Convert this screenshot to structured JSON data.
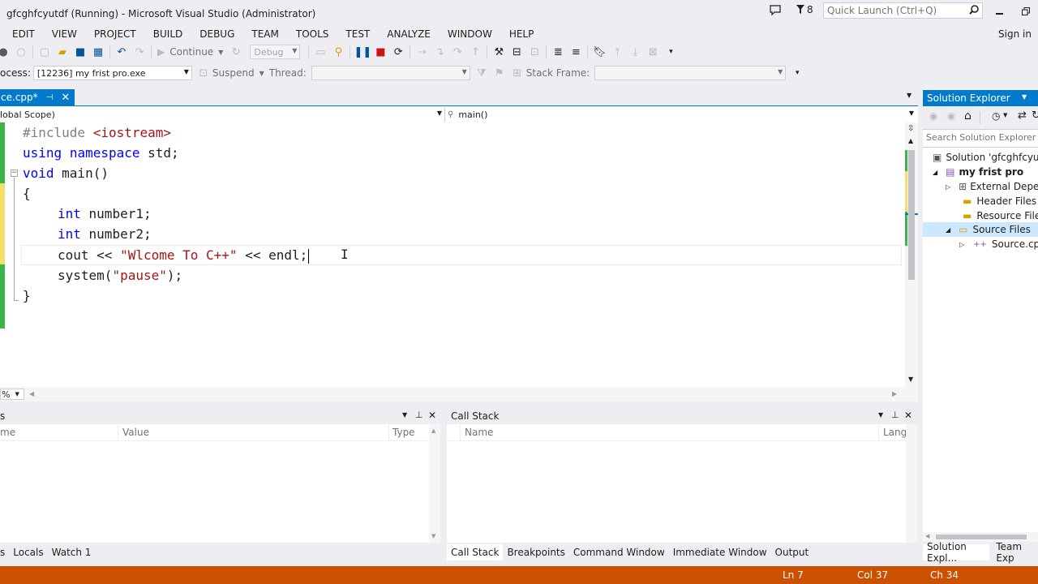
{
  "window": {
    "title": "gfcghfcyutdf (Running) - Microsoft Visual Studio (Administrator)",
    "notification_count": "8",
    "quick_launch_placeholder": "Quick Launch (Ctrl+Q)",
    "sign_in": "Sign in"
  },
  "menu": [
    "EDIT",
    "VIEW",
    "PROJECT",
    "BUILD",
    "DEBUG",
    "TEAM",
    "TOOLS",
    "TEST",
    "ANALYZE",
    "WINDOW",
    "HELP"
  ],
  "toolbar": {
    "continue_label": "Continue",
    "config_value": "Debug",
    "process_label": "ocess:",
    "process_value": "[12236] my frist pro.exe",
    "suspend_label": "Suspend",
    "thread_label": "Thread:",
    "stack_frame_label": "Stack Frame:"
  },
  "editor": {
    "tab_label": "ce.cpp*",
    "scope": "lobal Scope)",
    "function": "main()",
    "zoom": "%"
  },
  "code": {
    "l1_directive": "#include",
    "l1_header": " <iostream>",
    "l2_using": "using",
    "l2_namespace": "namespace",
    "l2_rest": " std;",
    "l3_void": "void",
    "l3_rest": " main()",
    "l4": "{",
    "l5_int": "int",
    "l5_rest": " number1;",
    "l6_int": "int",
    "l6_rest": " number2;",
    "l7_cout": "cout << ",
    "l7_str": "\"Wlcome To C++\"",
    "l7_rest": " << endl;",
    "l8_call": "system(",
    "l8_str": "\"pause\"",
    "l8_rest": ");",
    "l9": "}"
  },
  "locals_panel": {
    "title": "s",
    "columns": [
      "me",
      "Value",
      "Type"
    ],
    "tabs": [
      "s",
      "Locals",
      "Watch 1"
    ]
  },
  "callstack_panel": {
    "title": "Call Stack",
    "columns": [
      "Name",
      "Lang"
    ],
    "tabs": [
      "Call Stack",
      "Breakpoints",
      "Command Window",
      "Immediate Window",
      "Output"
    ]
  },
  "solution_explorer": {
    "title": "Solution Explorer",
    "search_placeholder": "Search Solution Explorer (",
    "nodes": [
      "Solution 'gfcghfcyutd",
      "my frist pro",
      "External Depen",
      "Header Files",
      "Resource Files",
      "Source Files",
      "Source.cpp"
    ],
    "tabs": [
      "Solution Expl...",
      "Team Exp"
    ]
  },
  "status": {
    "ln": "Ln 7",
    "col": "Col 37",
    "ch": "Ch 34"
  },
  "colors": {
    "accent": "#007acc",
    "status_debug": "#ca5100",
    "keyword": "#0000ff",
    "string": "#a31515"
  }
}
